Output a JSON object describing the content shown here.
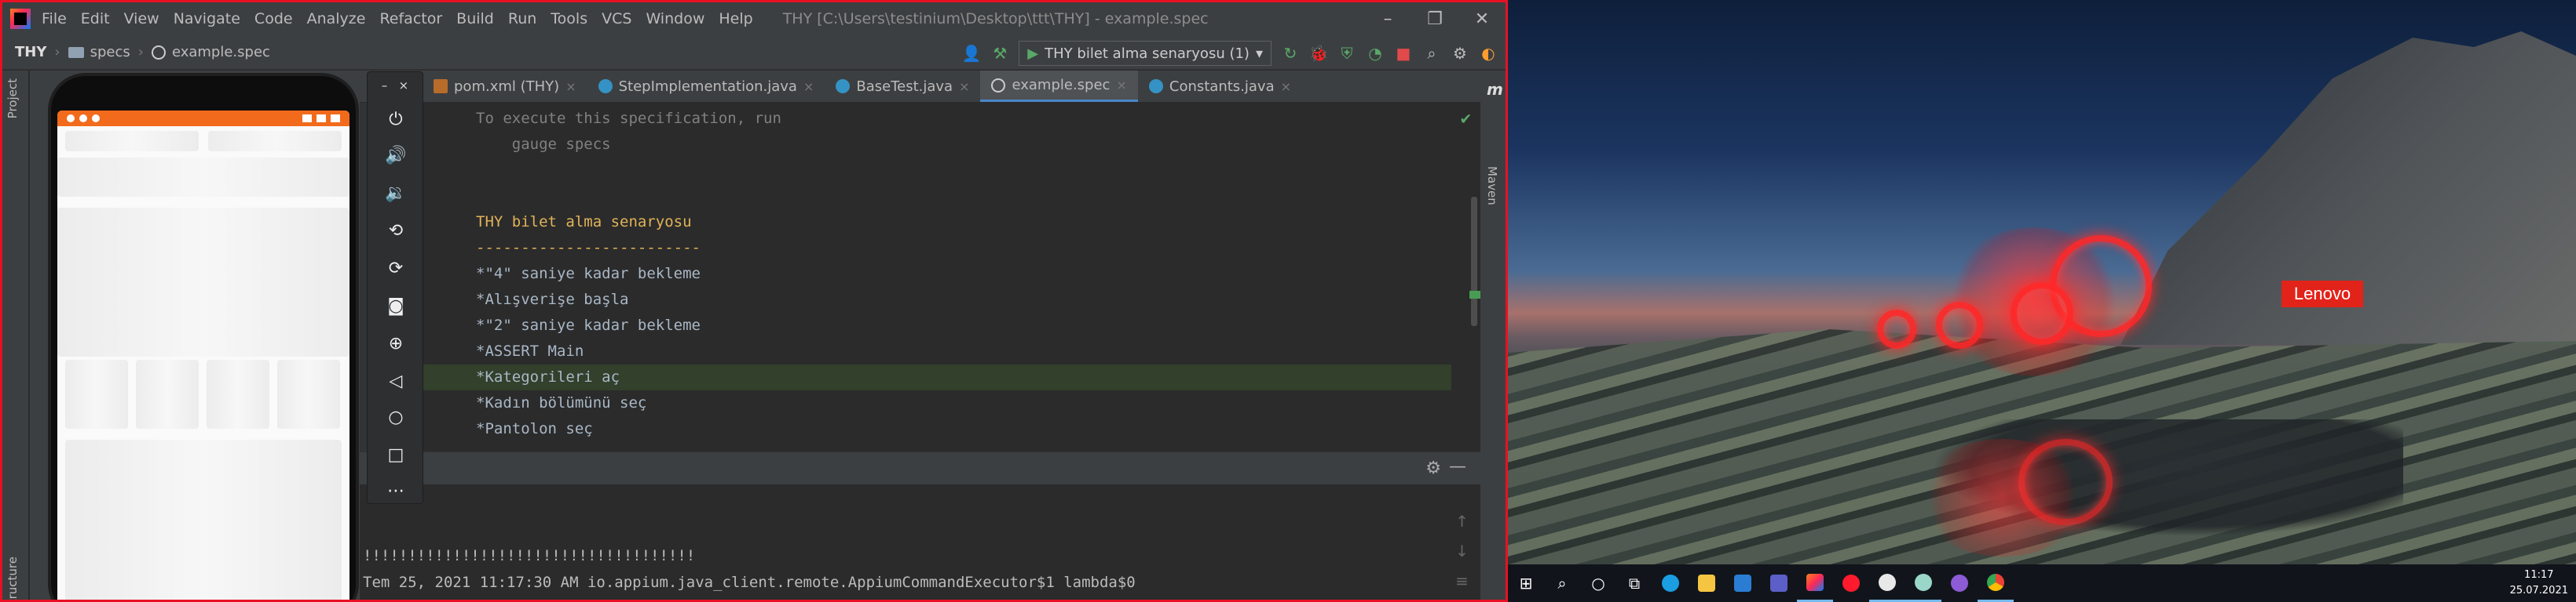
{
  "ide": {
    "menu": [
      "File",
      "Edit",
      "View",
      "Navigate",
      "Code",
      "Analyze",
      "Refactor",
      "Build",
      "Run",
      "Tools",
      "VCS",
      "Window",
      "Help"
    ],
    "window_title": "THY [C:\\Users\\testinium\\Desktop\\ttt\\THY] - example.spec",
    "breadcrumb": [
      "THY",
      "specs",
      "example.spec"
    ],
    "run_config": "THY bilet alma senaryosu (1)",
    "left_tabs": [
      "Project",
      "Structure"
    ],
    "right_tab": "Maven",
    "tabs": [
      {
        "label": "pom.xml (THY)",
        "icon": "maven-icon",
        "active": false
      },
      {
        "label": "StepImplementation.java",
        "icon": "class-icon",
        "active": false
      },
      {
        "label": "BaseTest.java",
        "icon": "class-icon",
        "active": false
      },
      {
        "label": "example.spec",
        "icon": "spec-icon",
        "active": true
      },
      {
        "label": "Constants.java",
        "icon": "class-icon",
        "active": false
      }
    ],
    "editor_lines": [
      "To execute this specification, run",
      "    gauge specs",
      "",
      "THY bilet alma senaryosu",
      "-------------------------",
      "*\"4\" saniye kadar bekleme",
      "*Alışverişe başla",
      "*\"2\" saniye kadar bekleme",
      "*ASSERT Main",
      "*Kategorileri aç",
      "*Kadın bölümünü seç",
      "*Pantolon seç"
    ],
    "console_lines": [
      "!!!!!!!!!!!!!!!!!!!!!!!!!!!!!!!!!!!!!",
      "Tem 25, 2021 11:17:30 AM io.appium.java_client.remote.AppiumCommandExecutor$1 lambda$0"
    ]
  },
  "emulator": {
    "buttons": [
      "power-icon",
      "volume-up-icon",
      "volume-down-icon",
      "rotate-left-icon",
      "rotate-right-icon",
      "camera-icon",
      "zoom-icon",
      "back-icon",
      "home-icon",
      "overview-icon",
      "more-icon"
    ],
    "accent_color": "#f26a1b"
  },
  "desktop": {
    "brand_badge": "Lenovo",
    "taskbar_icons": [
      "windows-start-icon",
      "search-icon",
      "cortana-icon",
      "task-view-icon",
      "edge-icon",
      "file-explorer-icon",
      "mail-icon",
      "teams-icon",
      "intellij-icon",
      "opera-icon",
      "app-icon",
      "emulator-icon",
      "app-icon-2",
      "chrome-icon"
    ],
    "clock_time": "11:17",
    "clock_date": "25.07.2021"
  }
}
